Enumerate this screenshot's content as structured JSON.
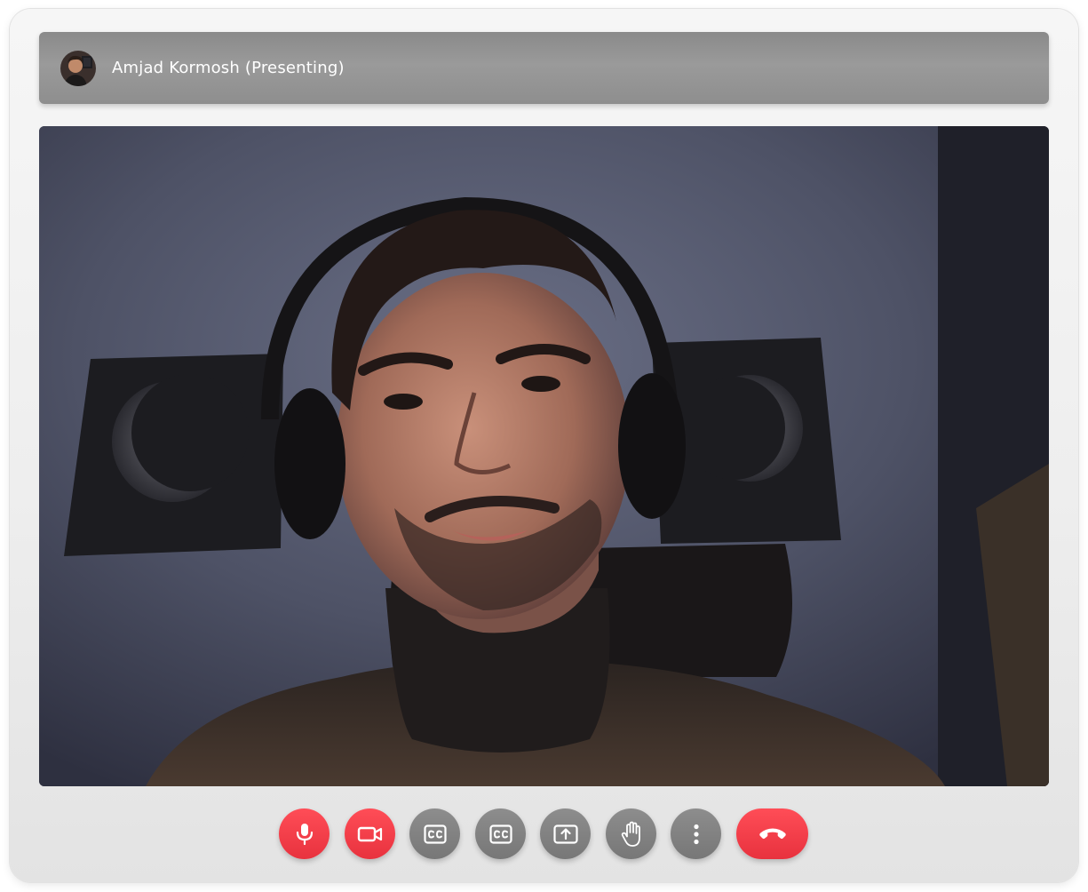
{
  "header": {
    "presenter_label": "Amjad Kormosh (Presenting)",
    "avatar_icon": "presenter-avatar"
  },
  "video": {
    "content": "presenter-camera-feed"
  },
  "controls": [
    {
      "name": "microphone-button",
      "icon": "microphone-icon",
      "state": "active",
      "color": "#ef3a45"
    },
    {
      "name": "camera-button",
      "icon": "video-camera-icon",
      "state": "active",
      "color": "#ef3a45"
    },
    {
      "name": "captions-button",
      "icon": "closed-captions-icon",
      "state": "off",
      "color": "#828282"
    },
    {
      "name": "captions-button-2",
      "icon": "closed-captions-icon",
      "state": "off",
      "color": "#828282"
    },
    {
      "name": "share-screen-button",
      "icon": "share-screen-icon",
      "state": "off",
      "color": "#828282"
    },
    {
      "name": "raise-hand-button",
      "icon": "raise-hand-icon",
      "state": "off",
      "color": "#828282"
    },
    {
      "name": "more-options-button",
      "icon": "more-vertical-icon",
      "state": "off",
      "color": "#828282"
    },
    {
      "name": "end-call-button",
      "icon": "hang-up-icon",
      "state": "active",
      "color": "#ef3a45"
    }
  ],
  "colors": {
    "accent_red": "#ef3a45",
    "control_grey": "#828282",
    "header_grey": "#939393"
  }
}
